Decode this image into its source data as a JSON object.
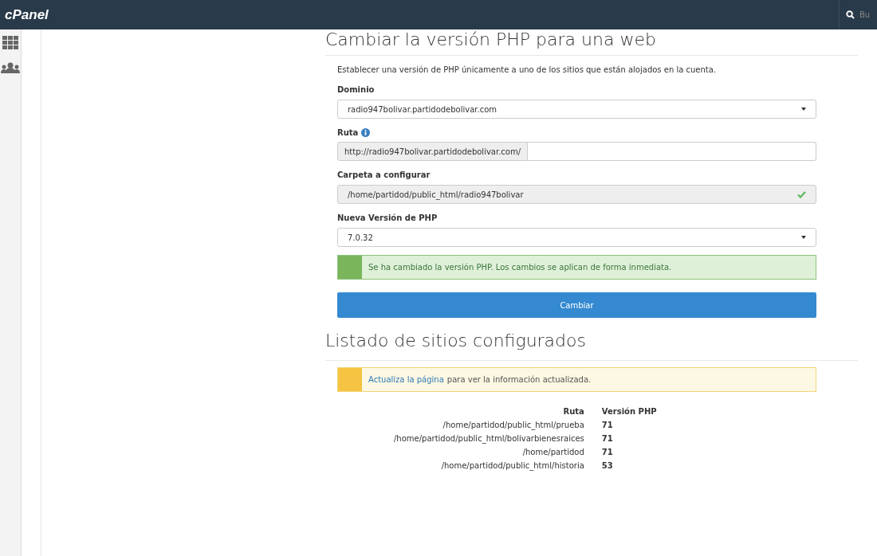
{
  "navbar": {
    "logo": "cPanel",
    "search": {
      "placeholder": "Bu"
    }
  },
  "sidebar": {
    "items": [
      {
        "kind": "grid"
      },
      {
        "kind": "users"
      }
    ]
  },
  "php_form": {
    "title": "Cambiar la versión PHP para una web",
    "description": "Establecer una versión de PHP únicamente a uno de los sitios que están alojados en la cuenta.",
    "domain": {
      "label": "Dominio",
      "value": "radio947bolivar.partidodebolivar.com"
    },
    "path": {
      "label": "Ruta",
      "prefix": "http://radio947bolivar.partidodebolivar.com/"
    },
    "folder": {
      "label": "Carpeta a configurar",
      "value": "/home/partidod/public_html/radio947bolivar",
      "valid": true
    },
    "version": {
      "label": "Nueva Versión de PHP",
      "value": "7.0.32"
    },
    "alert": {
      "kind": "success",
      "text": "Se ha cambiado la versión PHP. Los cambios se aplican de forma inmediata."
    },
    "submit": "Cambiar"
  },
  "sites": {
    "title": "Listado de sitios configurados",
    "alert": {
      "kind": "warning",
      "link": "Actualiza la página",
      "text": "para ver la información actualizada."
    },
    "table": {
      "columns": [
        "Ruta",
        "Versión PHP"
      ],
      "rows": [
        {
          "path": "/home/partidod/public_html/prueba",
          "version": "71"
        },
        {
          "path": "/home/partidod/public_html/bolivarbienesraices",
          "version": "71"
        },
        {
          "path": "/home/partidod",
          "version": "71"
        },
        {
          "path": "/home/partidod/public_html/historia",
          "version": "53"
        }
      ]
    }
  }
}
